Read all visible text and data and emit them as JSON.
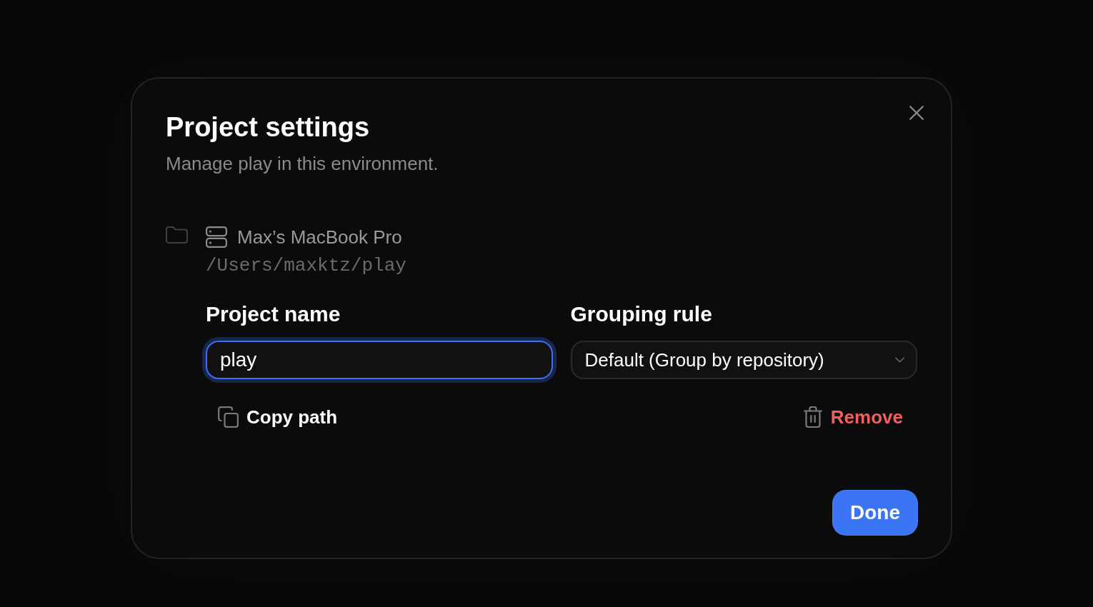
{
  "dialog": {
    "title": "Project settings",
    "subtitle": "Manage play in this environment."
  },
  "location": {
    "host": "Max’s MacBook Pro",
    "path": "/Users/maxktz/play"
  },
  "fields": [
    {
      "kind": "text",
      "label": "Project name",
      "value": "play",
      "focused": true
    },
    {
      "kind": "select",
      "label": "Grouping rule",
      "value": "Default (Group by repository)",
      "focused": false
    }
  ],
  "actions": [
    {
      "kind": "copy",
      "label": "Copy path"
    },
    {
      "kind": "remove",
      "label": "Remove"
    }
  ],
  "buttons": [
    {
      "label": "Done"
    }
  ]
}
